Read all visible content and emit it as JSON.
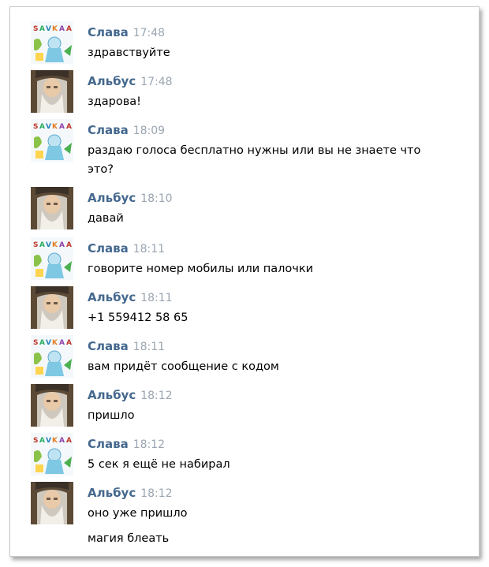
{
  "messages": [
    {
      "author": "Слава",
      "time": "17:48",
      "lines": [
        "здравствуйте"
      ]
    },
    {
      "author": "Альбус",
      "time": "17:48",
      "lines": [
        "здарова!"
      ]
    },
    {
      "author": "Слава",
      "time": "18:09",
      "lines": [
        "раздаю голоса бесплатно нужны или вы не знаете что",
        "это?"
      ]
    },
    {
      "author": "Альбус",
      "time": "18:10",
      "lines": [
        "давай"
      ]
    },
    {
      "author": "Слава",
      "time": "18:11",
      "lines": [
        "говорите номер мобилы или палочки"
      ]
    },
    {
      "author": "Альбус",
      "time": "18:11",
      "lines": [
        "+1 559412 58 65"
      ]
    },
    {
      "author": "Слава",
      "time": "18:11",
      "lines": [
        "вам придёт сообщение с кодом"
      ]
    },
    {
      "author": "Альбус",
      "time": "18:12",
      "lines": [
        "пришло"
      ]
    },
    {
      "author": "Слава",
      "time": "18:12",
      "lines": [
        "5 сек я ещё не набирал"
      ]
    },
    {
      "author": "Альбус",
      "time": "18:12",
      "lines": [
        "оно уже пришло",
        "магия блеать"
      ]
    }
  ],
  "colors": {
    "author": "#45688e",
    "time": "#9aa5b1",
    "text": "#000000",
    "border": "#c9c9c9"
  },
  "icons": {
    "slava": "cartoon-avatar-icon",
    "albus": "bearded-wizard-avatar-icon"
  }
}
